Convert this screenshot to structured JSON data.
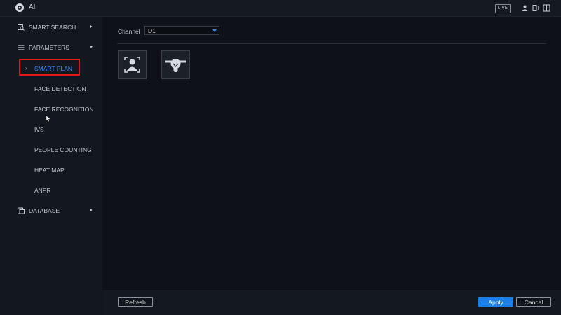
{
  "header": {
    "title": "AI",
    "live_label": "LIVE",
    "logo_icon": "camera-logo-icon",
    "icons": [
      "user-icon",
      "logout-icon",
      "grid-icon"
    ]
  },
  "sidebar": {
    "sections": [
      {
        "label": "SMART SEARCH",
        "icon": "search-doc-icon",
        "arrow": "chevron-right-icon"
      },
      {
        "label": "PARAMETERS",
        "icon": "list-icon",
        "arrow": "chevron-down-icon"
      },
      {
        "label": "DATABASE",
        "icon": "database-icon",
        "arrow": "chevron-right-icon"
      }
    ],
    "items": [
      {
        "label": "SMART PLAN",
        "active": true
      },
      {
        "label": "FACE DETECTION"
      },
      {
        "label": "FACE RECOGNITION"
      },
      {
        "label": "IVS"
      },
      {
        "label": "PEOPLE COUNTING"
      },
      {
        "label": "HEAT MAP"
      },
      {
        "label": "ANPR"
      }
    ],
    "active_chevron": "›"
  },
  "main": {
    "channel_label": "Channel",
    "channel_value": "D1",
    "plans": [
      {
        "icon": "face-recognition-icon"
      },
      {
        "icon": "smart-plan-bulb-icon"
      }
    ]
  },
  "footer": {
    "refresh_label": "Refresh",
    "apply_label": "Apply",
    "cancel_label": "Cancel"
  },
  "colors": {
    "accent": "#1a7fe8",
    "active_text": "#3d8bff",
    "highlight": "#e01818"
  }
}
